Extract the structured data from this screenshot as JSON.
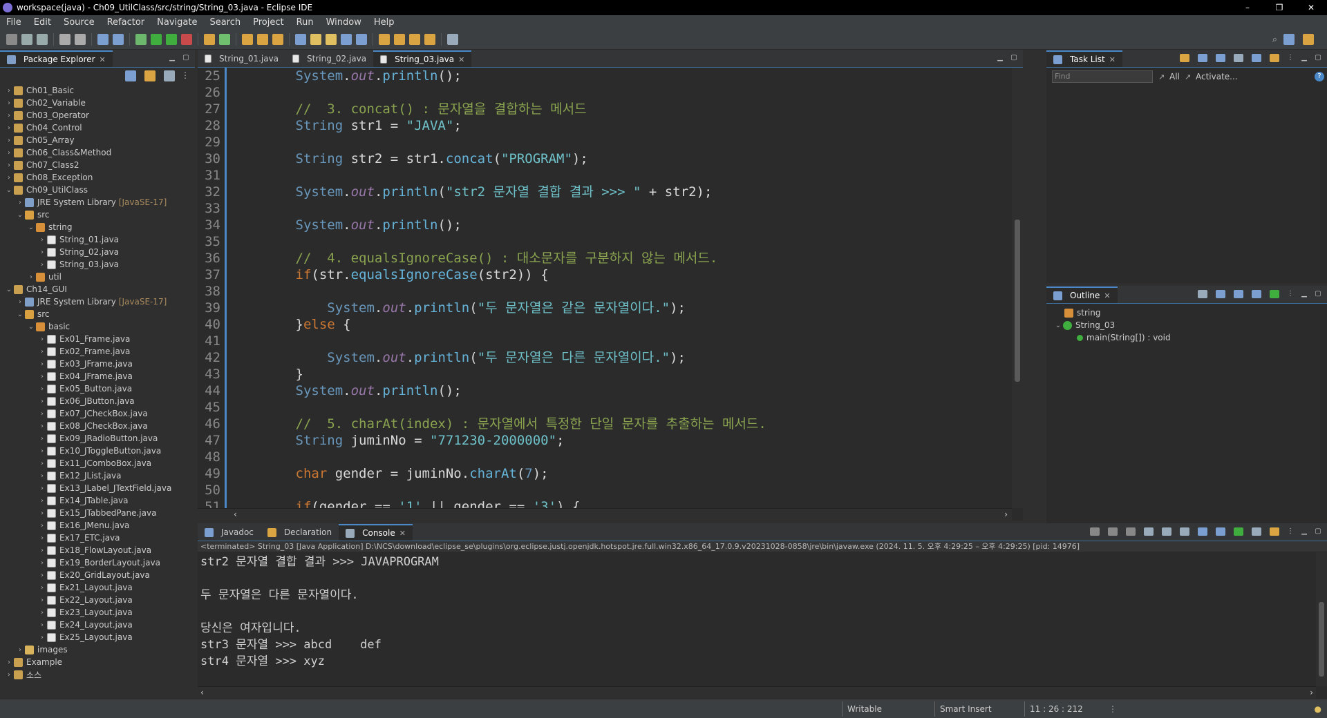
{
  "window": {
    "title": "workspace(java) - Ch09_UtilClass/src/string/String_03.java - Eclipse IDE",
    "minimize": "–",
    "restore": "❐",
    "close": "✕"
  },
  "menu": [
    "File",
    "Edit",
    "Source",
    "Refactor",
    "Navigate",
    "Search",
    "Project",
    "Run",
    "Window",
    "Help"
  ],
  "explorer": {
    "title": "Package Explorer",
    "items": [
      {
        "d": 0,
        "chev": "›",
        "icon": "proj",
        "label": "Ch01_Basic"
      },
      {
        "d": 0,
        "chev": "›",
        "icon": "proj",
        "label": "Ch02_Variable"
      },
      {
        "d": 0,
        "chev": "›",
        "icon": "proj",
        "label": "Ch03_Operator"
      },
      {
        "d": 0,
        "chev": "›",
        "icon": "proj",
        "label": "Ch04_Control"
      },
      {
        "d": 0,
        "chev": "›",
        "icon": "proj",
        "label": "Ch05_Array"
      },
      {
        "d": 0,
        "chev": "›",
        "icon": "proj",
        "label": "Ch06_Class&Method"
      },
      {
        "d": 0,
        "chev": "›",
        "icon": "proj",
        "label": "Ch07_Class2"
      },
      {
        "d": 0,
        "chev": "›",
        "icon": "proj",
        "label": "Ch08_Exception"
      },
      {
        "d": 0,
        "chev": "⌄",
        "icon": "proj",
        "label": "Ch09_UtilClass"
      },
      {
        "d": 1,
        "chev": "›",
        "icon": "lib",
        "label": "JRE System Library",
        "extra": "[JavaSE-17]"
      },
      {
        "d": 1,
        "chev": "⌄",
        "icon": "src",
        "label": "src"
      },
      {
        "d": 2,
        "chev": "⌄",
        "icon": "pkg",
        "label": "string"
      },
      {
        "d": 3,
        "chev": "›",
        "icon": "file",
        "label": "String_01.java"
      },
      {
        "d": 3,
        "chev": "›",
        "icon": "file",
        "label": "String_02.java"
      },
      {
        "d": 3,
        "chev": "›",
        "icon": "file",
        "label": "String_03.java"
      },
      {
        "d": 2,
        "chev": "›",
        "icon": "pkg",
        "label": "util"
      },
      {
        "d": 0,
        "chev": "⌄",
        "icon": "proj",
        "label": "Ch14_GUI"
      },
      {
        "d": 1,
        "chev": "›",
        "icon": "lib",
        "label": "JRE System Library",
        "extra": "[JavaSE-17]"
      },
      {
        "d": 1,
        "chev": "⌄",
        "icon": "src",
        "label": "src"
      },
      {
        "d": 2,
        "chev": "⌄",
        "icon": "pkg",
        "label": "basic"
      },
      {
        "d": 3,
        "chev": "›",
        "icon": "file",
        "label": "Ex01_Frame.java"
      },
      {
        "d": 3,
        "chev": "›",
        "icon": "file",
        "label": "Ex02_Frame.java"
      },
      {
        "d": 3,
        "chev": "›",
        "icon": "file",
        "label": "Ex03_JFrame.java"
      },
      {
        "d": 3,
        "chev": "›",
        "icon": "file",
        "label": "Ex04_JFrame.java"
      },
      {
        "d": 3,
        "chev": "›",
        "icon": "file",
        "label": "Ex05_Button.java"
      },
      {
        "d": 3,
        "chev": "›",
        "icon": "file",
        "label": "Ex06_JButton.java"
      },
      {
        "d": 3,
        "chev": "›",
        "icon": "file",
        "label": "Ex07_JCheckBox.java"
      },
      {
        "d": 3,
        "chev": "›",
        "icon": "file",
        "label": "Ex08_JCheckBox.java"
      },
      {
        "d": 3,
        "chev": "›",
        "icon": "file",
        "label": "Ex09_JRadioButton.java"
      },
      {
        "d": 3,
        "chev": "›",
        "icon": "file",
        "label": "Ex10_JToggleButton.java"
      },
      {
        "d": 3,
        "chev": "›",
        "icon": "file",
        "label": "Ex11_JComboBox.java"
      },
      {
        "d": 3,
        "chev": "›",
        "icon": "file",
        "label": "Ex12_JList.java"
      },
      {
        "d": 3,
        "chev": "›",
        "icon": "file",
        "label": "Ex13_JLabel_JTextField.java"
      },
      {
        "d": 3,
        "chev": "›",
        "icon": "file",
        "label": "Ex14_JTable.java"
      },
      {
        "d": 3,
        "chev": "›",
        "icon": "file",
        "label": "Ex15_JTabbedPane.java"
      },
      {
        "d": 3,
        "chev": "›",
        "icon": "file",
        "label": "Ex16_JMenu.java"
      },
      {
        "d": 3,
        "chev": "›",
        "icon": "file",
        "label": "Ex17_ETC.java"
      },
      {
        "d": 3,
        "chev": "›",
        "icon": "file",
        "label": "Ex18_FlowLayout.java"
      },
      {
        "d": 3,
        "chev": "›",
        "icon": "file",
        "label": "Ex19_BorderLayout.java"
      },
      {
        "d": 3,
        "chev": "›",
        "icon": "file",
        "label": "Ex20_GridLayout.java"
      },
      {
        "d": 3,
        "chev": "›",
        "icon": "file",
        "label": "Ex21_Layout.java"
      },
      {
        "d": 3,
        "chev": "›",
        "icon": "file",
        "label": "Ex22_Layout.java"
      },
      {
        "d": 3,
        "chev": "›",
        "icon": "file",
        "label": "Ex23_Layout.java"
      },
      {
        "d": 3,
        "chev": "›",
        "icon": "file",
        "label": "Ex24_Layout.java"
      },
      {
        "d": 3,
        "chev": "›",
        "icon": "file",
        "label": "Ex25_Layout.java"
      },
      {
        "d": 1,
        "chev": "›",
        "icon": "folder",
        "label": "images"
      },
      {
        "d": 0,
        "chev": "›",
        "icon": "proj",
        "label": "Example"
      },
      {
        "d": 0,
        "chev": "›",
        "icon": "proj",
        "label": "소스"
      }
    ]
  },
  "editor": {
    "tabs": [
      "String_01.java",
      "String_02.java",
      "String_03.java"
    ],
    "active_tab": 2,
    "lines": [
      {
        "n": "25",
        "segs": [
          [
            "        ",
            ""
          ],
          [
            "System",
            "cls"
          ],
          [
            ".",
            ""
          ],
          [
            "out",
            "fld"
          ],
          [
            ".",
            ""
          ],
          [
            "println",
            "fn"
          ],
          [
            "();",
            ""
          ]
        ]
      },
      {
        "n": "26",
        "segs": []
      },
      {
        "n": "27",
        "segs": [
          [
            "        ",
            ""
          ],
          [
            "//  3. concat() : 문자열을 결합하는 메서드",
            "cm"
          ]
        ]
      },
      {
        "n": "28",
        "segs": [
          [
            "        ",
            ""
          ],
          [
            "String",
            "cls"
          ],
          [
            " str1 = ",
            ""
          ],
          [
            "\"JAVA\"",
            "str"
          ],
          [
            ";",
            ""
          ]
        ]
      },
      {
        "n": "29",
        "segs": []
      },
      {
        "n": "30",
        "segs": [
          [
            "        ",
            ""
          ],
          [
            "String",
            "cls"
          ],
          [
            " str2 = str1.",
            ""
          ],
          [
            "concat",
            "fn"
          ],
          [
            "(",
            ""
          ],
          [
            "\"PROGRAM\"",
            "str"
          ],
          [
            ");",
            ""
          ]
        ]
      },
      {
        "n": "31",
        "segs": []
      },
      {
        "n": "32",
        "segs": [
          [
            "        ",
            ""
          ],
          [
            "System",
            "cls"
          ],
          [
            ".",
            ""
          ],
          [
            "out",
            "fld"
          ],
          [
            ".",
            ""
          ],
          [
            "println",
            "fn"
          ],
          [
            "(",
            ""
          ],
          [
            "\"str2 문자열 결합 결과 >>> \"",
            "str"
          ],
          [
            " + str2);",
            ""
          ]
        ]
      },
      {
        "n": "33",
        "segs": []
      },
      {
        "n": "34",
        "segs": [
          [
            "        ",
            ""
          ],
          [
            "System",
            "cls"
          ],
          [
            ".",
            ""
          ],
          [
            "out",
            "fld"
          ],
          [
            ".",
            ""
          ],
          [
            "println",
            "fn"
          ],
          [
            "();",
            ""
          ]
        ]
      },
      {
        "n": "35",
        "segs": []
      },
      {
        "n": "36",
        "segs": [
          [
            "        ",
            ""
          ],
          [
            "//  4. equalsIgnoreCase() : 대소문자를 구분하지 않는 메서드.",
            "cm"
          ]
        ]
      },
      {
        "n": "37",
        "segs": [
          [
            "        ",
            ""
          ],
          [
            "if",
            "kw"
          ],
          [
            "(str.",
            ""
          ],
          [
            "equalsIgnoreCase",
            "fn"
          ],
          [
            "(str2)) {",
            ""
          ]
        ]
      },
      {
        "n": "38",
        "segs": []
      },
      {
        "n": "39",
        "segs": [
          [
            "            ",
            ""
          ],
          [
            "System",
            "cls"
          ],
          [
            ".",
            ""
          ],
          [
            "out",
            "fld"
          ],
          [
            ".",
            ""
          ],
          [
            "println",
            "fn"
          ],
          [
            "(",
            ""
          ],
          [
            "\"두 문자열은 같은 문자열이다.\"",
            "str"
          ],
          [
            ");",
            ""
          ]
        ]
      },
      {
        "n": "40",
        "segs": [
          [
            "        }",
            ""
          ],
          [
            "else",
            "kw"
          ],
          [
            " {",
            ""
          ]
        ]
      },
      {
        "n": "41",
        "segs": []
      },
      {
        "n": "42",
        "segs": [
          [
            "            ",
            ""
          ],
          [
            "System",
            "cls"
          ],
          [
            ".",
            ""
          ],
          [
            "out",
            "fld"
          ],
          [
            ".",
            ""
          ],
          [
            "println",
            "fn"
          ],
          [
            "(",
            ""
          ],
          [
            "\"두 문자열은 다른 문자열이다.\"",
            "str"
          ],
          [
            ");",
            ""
          ]
        ]
      },
      {
        "n": "43",
        "segs": [
          [
            "        }",
            ""
          ]
        ]
      },
      {
        "n": "44",
        "segs": [
          [
            "        ",
            ""
          ],
          [
            "System",
            "cls"
          ],
          [
            ".",
            ""
          ],
          [
            "out",
            "fld"
          ],
          [
            ".",
            ""
          ],
          [
            "println",
            "fn"
          ],
          [
            "();",
            ""
          ]
        ]
      },
      {
        "n": "45",
        "segs": []
      },
      {
        "n": "46",
        "segs": [
          [
            "        ",
            ""
          ],
          [
            "//  5. charAt(index) : 문자열에서 특정한 단일 문자를 추출하는 메서드.",
            "cm"
          ]
        ]
      },
      {
        "n": "47",
        "segs": [
          [
            "        ",
            ""
          ],
          [
            "String",
            "cls"
          ],
          [
            " juminNo = ",
            ""
          ],
          [
            "\"771230-2000000\"",
            "str"
          ],
          [
            ";",
            ""
          ]
        ]
      },
      {
        "n": "48",
        "segs": []
      },
      {
        "n": "49",
        "segs": [
          [
            "        ",
            ""
          ],
          [
            "char",
            "kw"
          ],
          [
            " gender = juminNo.",
            ""
          ],
          [
            "charAt",
            "fn"
          ],
          [
            "(",
            ""
          ],
          [
            "7",
            "num"
          ],
          [
            ");",
            ""
          ]
        ]
      },
      {
        "n": "50",
        "segs": []
      },
      {
        "n": "51",
        "segs": [
          [
            "        ",
            ""
          ],
          [
            "if",
            "kw"
          ],
          [
            "(gender == ",
            ""
          ],
          [
            "'1'",
            "str"
          ],
          [
            " || gender == ",
            ""
          ],
          [
            "'3'",
            "str"
          ],
          [
            ") {",
            ""
          ]
        ]
      }
    ]
  },
  "tasklist": {
    "title": "Task List",
    "find_placeholder": "Find",
    "all": "All",
    "activate": "Activate..."
  },
  "outline": {
    "title": "Outline",
    "pkg": "string",
    "cls": "String_03",
    "method": "main(String[]) : void"
  },
  "console": {
    "tabs": [
      "Javadoc",
      "Declaration",
      "Console"
    ],
    "header": "<terminated> String_03 [Java Application] D:\\NCS\\download\\eclipse_se\\plugins\\org.eclipse.justj.openjdk.hotspot.jre.full.win32.x86_64_17.0.9.v20231028-0858\\jre\\bin\\javaw.exe  (2024. 11. 5. 오후 4:29:25 – 오후 4:29:25) [pid: 14976]",
    "output": [
      "str2 문자열 결합 결과 >>> JAVAPROGRAM",
      "",
      "두 문자열은 다른 문자열이다.",
      "",
      "당신은 여자입니다.",
      "str3 문자열 >>> abcd    def",
      "str4 문자열 >>> xyz"
    ]
  },
  "status": {
    "writable": "Writable",
    "insert": "Smart Insert",
    "position": "11 : 26 : 212"
  }
}
